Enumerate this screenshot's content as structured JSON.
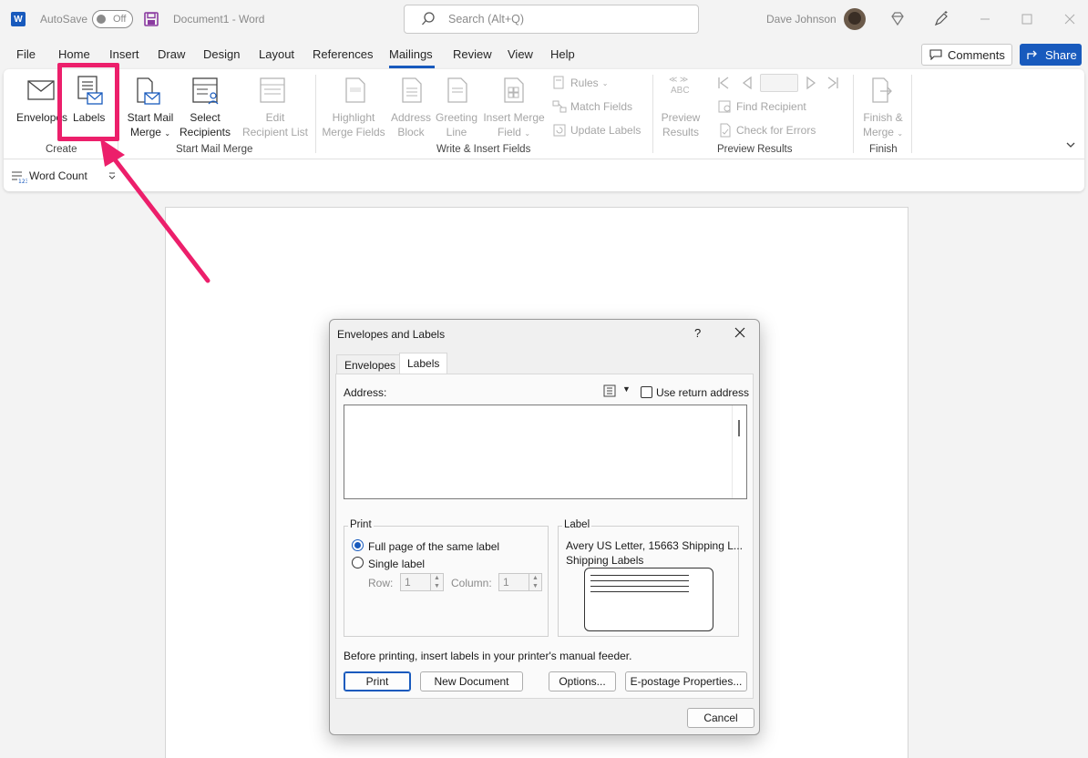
{
  "titlebar": {
    "app_logo": "W",
    "autosave_label": "AutoSave",
    "autosave_state": "Off",
    "doc_title": "Document1  -  Word",
    "search_placeholder": "Search (Alt+Q)",
    "user_name": "Dave Johnson"
  },
  "menu": {
    "items": [
      "File",
      "Home",
      "Insert",
      "Draw",
      "Design",
      "Layout",
      "References",
      "Mailings",
      "Review",
      "View",
      "Help"
    ],
    "active": "Mailings",
    "comments_label": "Comments",
    "share_label": "Share"
  },
  "ribbon": {
    "create": {
      "envelopes": "Envelopes",
      "labels": "Labels",
      "group": "Create"
    },
    "start_mail_merge": {
      "start_line1": "Start Mail",
      "start_line2": "Merge",
      "select_line1": "Select",
      "select_line2": "Recipients",
      "edit_line1": "Edit",
      "edit_line2": "Recipient List",
      "group": "Start Mail Merge"
    },
    "write_insert": {
      "highlight_line1": "Highlight",
      "highlight_line2": "Merge Fields",
      "address_line1": "Address",
      "address_line2": "Block",
      "greeting_line1": "Greeting",
      "greeting_line2": "Line",
      "insert_line1": "Insert Merge",
      "insert_line2": "Field",
      "rules": "Rules",
      "match_fields": "Match Fields",
      "update_labels": "Update Labels",
      "group": "Write & Insert Fields"
    },
    "preview": {
      "abc": "ABC",
      "preview_line1": "Preview",
      "preview_line2": "Results",
      "find_recipient": "Find Recipient",
      "check_errors": "Check for Errors",
      "group": "Preview Results"
    },
    "finish": {
      "finish_line1": "Finish &",
      "finish_line2": "Merge",
      "group": "Finish"
    },
    "word_count": "Word Count"
  },
  "dialog": {
    "title": "Envelopes and Labels",
    "help": "?",
    "tabs": [
      "Envelopes",
      "Labels"
    ],
    "active_tab": "Labels",
    "address_label": "Address:",
    "use_return_address": "Use return address",
    "address_value": "",
    "print_group": "Print",
    "full_page": "Full page of the same label",
    "single_label": "Single label",
    "row_label": "Row:",
    "row_value": "1",
    "column_label": "Column:",
    "column_value": "1",
    "label_group": "Label",
    "label_name": "Avery US Letter, 15663 Shipping L...",
    "label_type": "Shipping Labels",
    "notice": "Before printing, insert labels in your printer's manual feeder.",
    "print_btn": "Print",
    "new_document_btn": "New Document",
    "options_btn": "Options...",
    "epostage_btn": "E-postage Properties...",
    "cancel_btn": "Cancel"
  },
  "colors": {
    "accent": "#185abd",
    "highlight": "#ec1f6b"
  }
}
